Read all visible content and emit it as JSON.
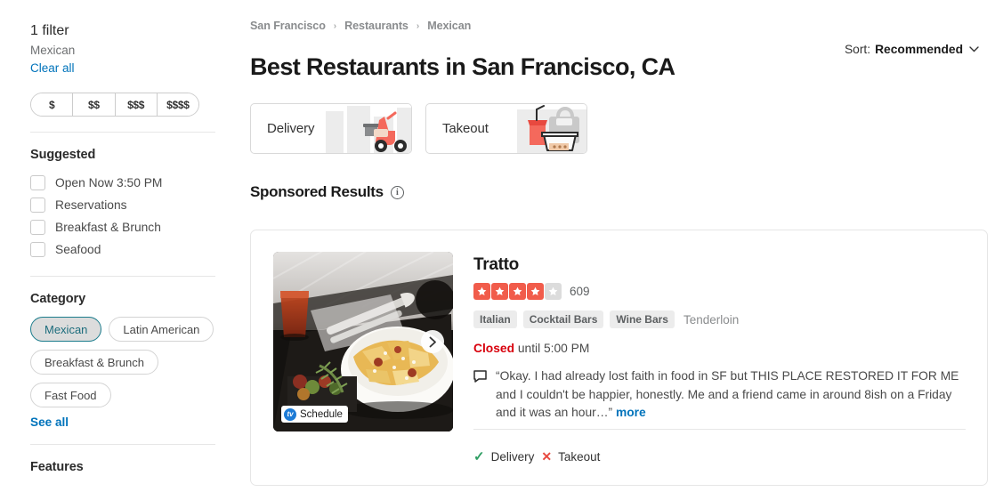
{
  "sidebar": {
    "filter_count": "1 filter",
    "filter_value": "Mexican",
    "clear_all": "Clear all",
    "price_options": [
      "$",
      "$$",
      "$$$",
      "$$$$"
    ],
    "suggested": {
      "title": "Suggested",
      "items": [
        {
          "label": "Open Now 3:50 PM",
          "checked": false
        },
        {
          "label": "Reservations",
          "checked": false
        },
        {
          "label": "Breakfast & Brunch",
          "checked": false
        },
        {
          "label": "Seafood",
          "checked": false
        }
      ]
    },
    "category": {
      "title": "Category",
      "pills": [
        {
          "label": "Mexican",
          "selected": true
        },
        {
          "label": "Latin American",
          "selected": false
        },
        {
          "label": "Breakfast & Brunch",
          "selected": false
        },
        {
          "label": "Fast Food",
          "selected": false
        }
      ],
      "see_all": "See all"
    },
    "features": {
      "title": "Features"
    }
  },
  "header": {
    "breadcrumb": [
      "San Francisco",
      "Restaurants",
      "Mexican"
    ],
    "breadcrumb_separator": "›",
    "title": "Best Restaurants in San Francisco, CA",
    "sort_label": "Sort:",
    "sort_value": "Recommended",
    "sort_caret": "⌄"
  },
  "modes": [
    {
      "label": "Delivery",
      "icon": "scooter-icon"
    },
    {
      "label": "Takeout",
      "icon": "takeout-bag-icon"
    }
  ],
  "sponsored": {
    "title": "Sponsored Results",
    "info_glyph": "i"
  },
  "result": {
    "name": "Tratto",
    "rating": 4,
    "max_rating": 5,
    "review_count": "609",
    "tags": [
      "Italian",
      "Cocktail Bars",
      "Wine Bars"
    ],
    "neighborhood": "Tenderloin",
    "status": "Closed",
    "status_detail": "until 5:00 PM",
    "review_quote": "“Okay. I had already lost faith in food in SF but THIS PLACE RESTORED IT FOR ME and I couldn't be happier, honestly. Me and a friend came in around 8ish on a Friday and it was an hour…” ",
    "more_label": "more",
    "photo_badge": "Schedule",
    "photo_next": "›",
    "services": [
      {
        "label": "Delivery",
        "available": true,
        "mark": "✓"
      },
      {
        "label": "Takeout",
        "available": false,
        "mark": "✕"
      }
    ]
  },
  "colors": {
    "link": "#0073bb",
    "star_on": "#f15c4b",
    "star_off": "#dcdcdc",
    "closed": "#d8000c",
    "available": "#2e9e63",
    "unavailable": "#e8493f",
    "selected_pill_border": "#1c7c8c"
  }
}
